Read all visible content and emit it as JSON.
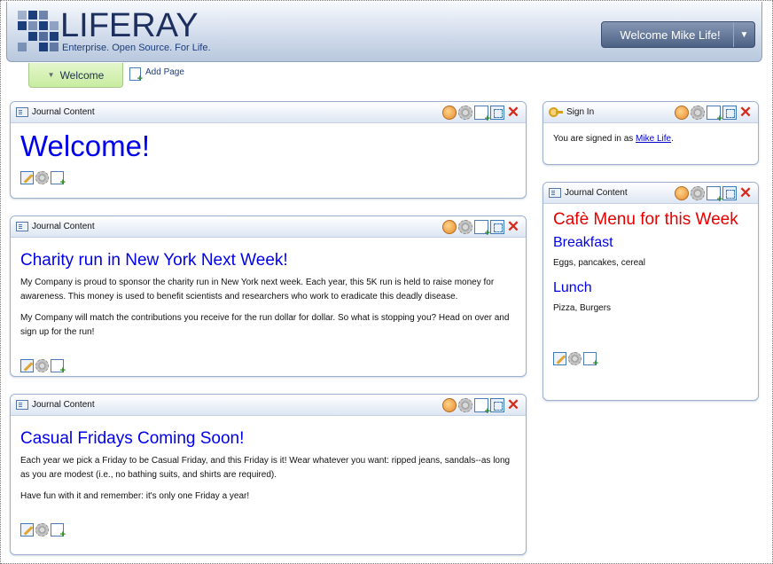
{
  "header": {
    "logo_text": "LIFERAY",
    "logo_tagline": "Enterprise. Open Source. For Life.",
    "user_menu_label": "Welcome Mike Life!"
  },
  "nav": {
    "tabs": [
      {
        "label": "Welcome",
        "selected": true
      }
    ],
    "add_page_label": "Add Page"
  },
  "portlets": {
    "welcome": {
      "title": "Journal Content",
      "heading": "Welcome!"
    },
    "charity": {
      "title": "Journal Content",
      "heading": "Charity run in New York Next Week!",
      "paragraphs": [
        "My Company is proud to sponsor the charity run in New York next week. Each year, this 5K run is held to raise money for awareness. This money is used to benefit scientists and researchers who work to eradicate this deadly disease.",
        "My Company will match the contributions you receive for the run dollar for dollar. So what is stopping you? Head on over and sign up for the run!"
      ]
    },
    "casual": {
      "title": "Journal Content",
      "heading": "Casual Fridays Coming Soon!",
      "paragraphs": [
        "Each year we pick a Friday to be Casual Friday, and this Friday is it! Wear whatever you want: ripped jeans, sandals--as long as you are modest (i.e., no bathing suits, and shirts are required).",
        "Have fun with it and remember: it's only one Friday a year!"
      ]
    },
    "signin": {
      "title": "Sign In",
      "text_prefix": "You are signed in as ",
      "user_link": "Mike Life",
      "text_suffix": "."
    },
    "menu": {
      "title": "Journal Content",
      "heading": "Cafè Menu for this Week",
      "sections": [
        {
          "heading": "Breakfast",
          "text": "Eggs, pancakes, cereal"
        },
        {
          "heading": "Lunch",
          "text": "Pizza, Burgers"
        }
      ]
    }
  },
  "colors": {
    "link_blue": "#0000ee",
    "menu_red": "#e60000",
    "tab_green": "#c8eca0",
    "header_blue": "#cfdaea"
  }
}
